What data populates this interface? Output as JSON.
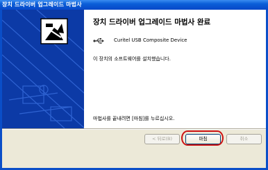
{
  "window": {
    "title": "장치 드라이버 업그레이드 마법사"
  },
  "main": {
    "heading": "장치 드라이버 업그레이드 마법사 완료",
    "device": {
      "name": "Curitel USB Composite Device",
      "icon": "usb-icon"
    },
    "installed_text": "이 장치의 소프트웨어를 설치했습니다.",
    "finish_instruction": "마법사를 끝내려면 [마침]를 누르십시오."
  },
  "buttons": {
    "back_label": "< 뒤로(B)",
    "finish_label": "마침",
    "cancel_label": "취소"
  },
  "colors": {
    "side_panel": "#0c3aa6",
    "highlight": "#cc1111"
  }
}
